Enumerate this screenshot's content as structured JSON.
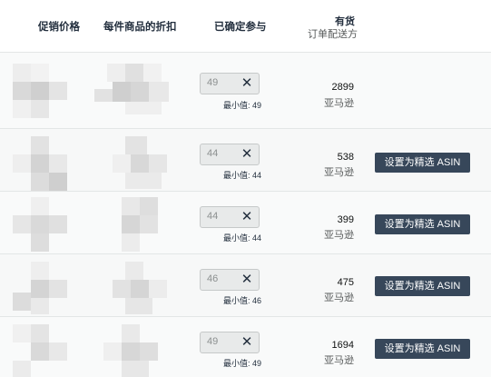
{
  "header": {
    "promo_price": "促销价格",
    "per_unit_discount": "每件商品的折扣",
    "committed_qty": "已确定参与",
    "stock_title": "有货",
    "stock_sub": "订单配送方"
  },
  "rows": [
    {
      "qty": "49",
      "min_label": "最小值: 49",
      "units": "2899",
      "store": "亚马逊",
      "button": ""
    },
    {
      "qty": "44",
      "min_label": "最小值: 44",
      "units": "538",
      "store": "亚马逊",
      "button": "设置为精选 ASIN"
    },
    {
      "qty": "44",
      "min_label": "最小值: 44",
      "units": "399",
      "store": "亚马逊",
      "button": "设置为精选 ASIN"
    },
    {
      "qty": "46",
      "min_label": "最小值: 46",
      "units": "475",
      "store": "亚马逊",
      "button": "设置为精选 ASIN"
    },
    {
      "qty": "49",
      "min_label": "最小值: 49",
      "units": "1694",
      "store": "亚马逊",
      "button": "设置为精选 ASIN"
    }
  ],
  "icons": {
    "clear": "close-icon"
  },
  "colors": {
    "button_bg": "#37475a",
    "header_text": "#232f3e"
  }
}
